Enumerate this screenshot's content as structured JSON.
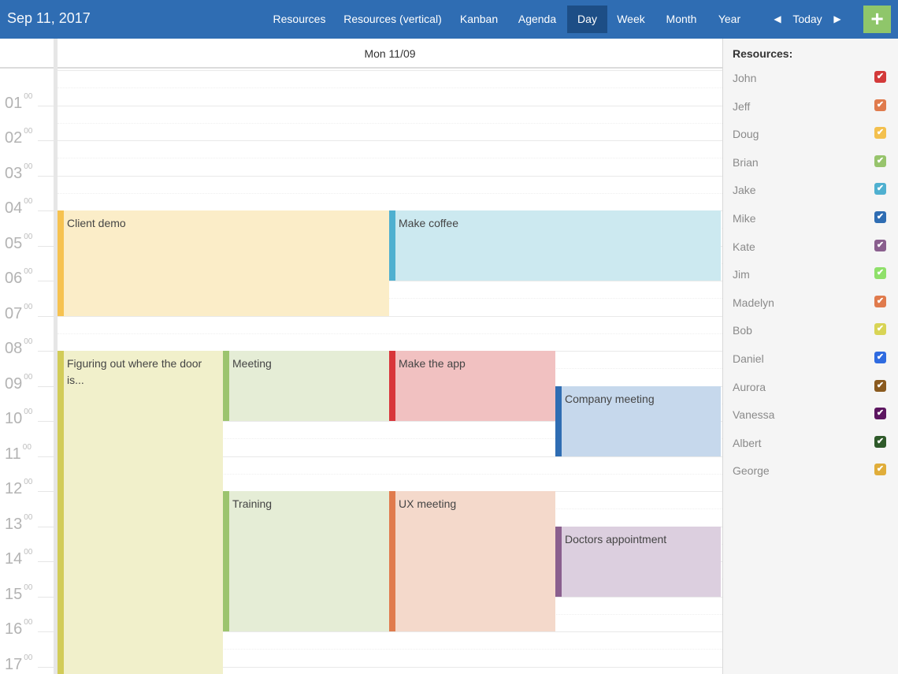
{
  "header": {
    "date": "Sep 11, 2017",
    "views": [
      "Resources",
      "Resources (vertical)",
      "Kanban",
      "Agenda",
      "Day",
      "Week",
      "Month",
      "Year"
    ],
    "active_view": "Day",
    "today_label": "Today",
    "prev_icon": "triangle-left-icon",
    "next_icon": "triangle-right-icon",
    "add_icon": "plus-icon",
    "add_label": "+",
    "colors": {
      "bar": "#2f6db3",
      "active": "#1d4e86",
      "add": "#8fc66a"
    }
  },
  "calendar": {
    "day_label": "Mon 11/09",
    "hours": [
      {
        "h": "01",
        "m": "00"
      },
      {
        "h": "02",
        "m": "00"
      },
      {
        "h": "03",
        "m": "00"
      },
      {
        "h": "04",
        "m": "00"
      },
      {
        "h": "05",
        "m": "00"
      },
      {
        "h": "06",
        "m": "00"
      },
      {
        "h": "07",
        "m": "00"
      },
      {
        "h": "08",
        "m": "00"
      },
      {
        "h": "09",
        "m": "00"
      },
      {
        "h": "10",
        "m": "00"
      },
      {
        "h": "11",
        "m": "00"
      },
      {
        "h": "12",
        "m": "00"
      },
      {
        "h": "13",
        "m": "00"
      },
      {
        "h": "14",
        "m": "00"
      },
      {
        "h": "15",
        "m": "00"
      },
      {
        "h": "16",
        "m": "00"
      },
      {
        "h": "17",
        "m": "00"
      }
    ],
    "events": [
      {
        "title": "Client demo",
        "accent": "#f6c250",
        "bg": "#fbedc8"
      },
      {
        "title": "Make coffee",
        "accent": "#4fb0d0",
        "bg": "#cce9f0"
      },
      {
        "title": "Figuring out where the door is...",
        "accent": "#d2cc58",
        "bg": "#f1f0cb"
      },
      {
        "title": "Meeting",
        "accent": "#9cc46e",
        "bg": "#e5edd6"
      },
      {
        "title": "Make the app",
        "accent": "#d8353a",
        "bg": "#f1c1c1"
      },
      {
        "title": "Company meeting",
        "accent": "#2f6db3",
        "bg": "#c6d8ec"
      },
      {
        "title": "Training",
        "accent": "#9cc46e",
        "bg": "#e5edd6"
      },
      {
        "title": "UX meeting",
        "accent": "#e07b4d",
        "bg": "#f4d9cb"
      },
      {
        "title": "Doctors appointment",
        "accent": "#8a5f8e",
        "bg": "#dccfdf"
      }
    ]
  },
  "sidebar": {
    "heading": "Resources:",
    "resources": [
      {
        "name": "John",
        "color": "#d33a3a"
      },
      {
        "name": "Jeff",
        "color": "#e07b4d"
      },
      {
        "name": "Doug",
        "color": "#f3c04e"
      },
      {
        "name": "Brian",
        "color": "#97c46c"
      },
      {
        "name": "Jake",
        "color": "#4fb0d0"
      },
      {
        "name": "Mike",
        "color": "#2f6db3"
      },
      {
        "name": "Kate",
        "color": "#8a5f8e"
      },
      {
        "name": "Jim",
        "color": "#8fe06a"
      },
      {
        "name": "Madelyn",
        "color": "#e07b4d"
      },
      {
        "name": "Bob",
        "color": "#d8d455"
      },
      {
        "name": "Daniel",
        "color": "#2f6be0"
      },
      {
        "name": "Aurora",
        "color": "#8a5a1f"
      },
      {
        "name": "Vanessa",
        "color": "#5c1660"
      },
      {
        "name": "Albert",
        "color": "#2f5a2a"
      },
      {
        "name": "George",
        "color": "#e0ad3a"
      }
    ],
    "check_icon": "check-icon",
    "check_glyph": "✔"
  }
}
